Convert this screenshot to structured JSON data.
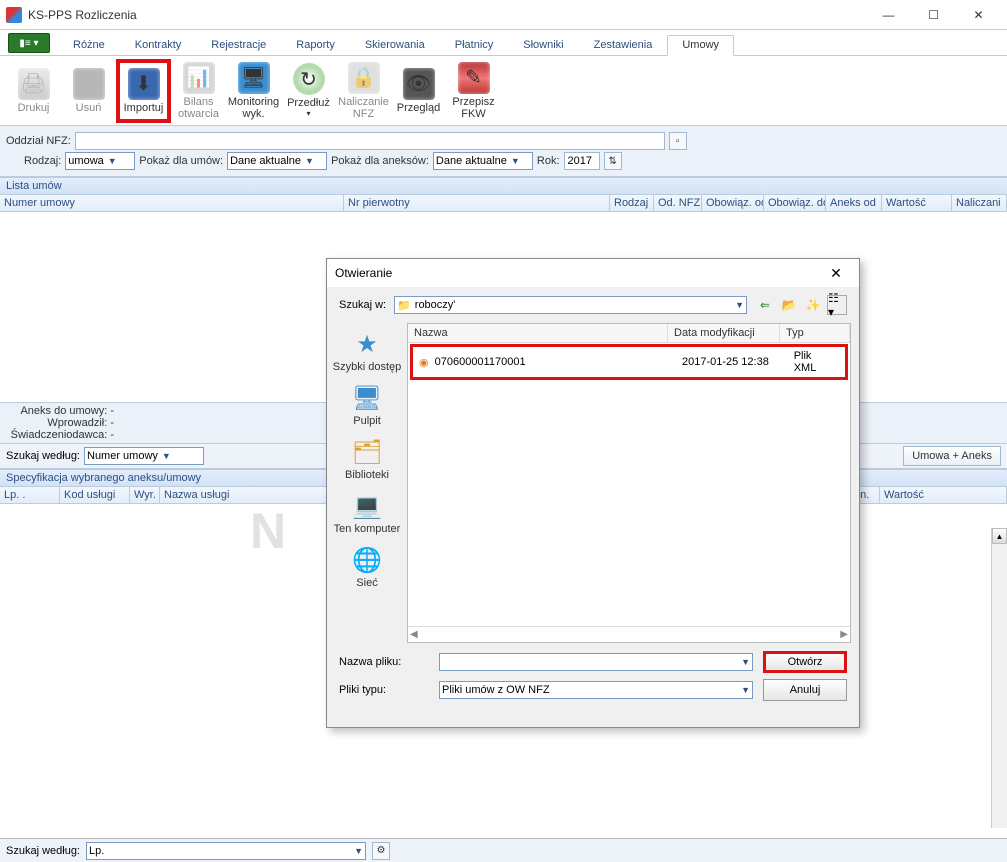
{
  "titlebar": {
    "title": "KS-PPS Rozliczenia"
  },
  "menu": {
    "items": [
      "Różne",
      "Kontrakty",
      "Rejestracje",
      "Raporty",
      "Skierowania",
      "Płatnicy",
      "Słowniki",
      "Zestawienia",
      "Umowy"
    ],
    "active": "Umowy"
  },
  "ribbon": {
    "drukuj": "Drukuj",
    "usun": "Usuń",
    "importuj": "Importuj",
    "bilans": "Bilans otwarcia",
    "monitoring": "Monitoring wyk.",
    "przedluz": "Przedłuż",
    "naliczanie": "Naliczanie NFZ",
    "przeglad": "Przegląd",
    "przepisz": "Przepisz FKW"
  },
  "filters": {
    "oddzial_label": "Oddział NFZ:",
    "rodzaj_label": "Rodzaj:",
    "rodzaj_value": "umowa",
    "pokaz_umow_label": "Pokaż dla umów:",
    "pokaz_umow_value": "Dane aktualne",
    "pokaz_aneks_label": "Pokaż dla aneksów:",
    "pokaz_aneks_value": "Dane aktualne",
    "rok_label": "Rok:",
    "rok_value": "2017"
  },
  "sections": {
    "lista_umow": "Lista umów",
    "spec": "Specyfikacja wybranego aneksu/umowy"
  },
  "cols1": [
    "Numer umowy",
    "Nr pierwotny",
    "Rodzaj",
    "Od. NFZ",
    "Obowiąz. od",
    "Obowiąz. do",
    "Aneks od",
    "Wartość",
    "Naliczani"
  ],
  "info": {
    "aneks": "Aneks do umowy: -",
    "wprowadzil": "Wprowadził: -",
    "swiad": "Świadczeniodawca: -",
    "szukaj_label": "Szukaj według:",
    "szukaj_value": "Numer umowy",
    "btn_umowa_aneks": "Umowa + Aneks"
  },
  "cols2": [
    "Lp. .",
    "Kod usługi",
    "Wyr.",
    "Nazwa usługi",
    "ena jedn.",
    "Wartość"
  ],
  "bottom": {
    "szukaj_label": "Szukaj według:",
    "szukaj_value": "Lp."
  },
  "dialog": {
    "title": "Otwieranie",
    "szukaj_w": "Szukaj w:",
    "folder": "roboczy'",
    "side": [
      "Szybki dostęp",
      "Pulpit",
      "Biblioteki",
      "Ten komputer",
      "Sieć"
    ],
    "head": {
      "nazwa": "Nazwa",
      "data": "Data modyfikacji",
      "typ": "Typ"
    },
    "row": {
      "name": "070600001170001",
      "date": "2017-01-25 12:38",
      "type": "Plik XML"
    },
    "nazwa_pliku": "Nazwa pliku:",
    "pliki_typu": "Pliki typu:",
    "typ_value": "Pliki umów z OW NFZ",
    "otworz": "Otwórz",
    "anuluj": "Anuluj"
  },
  "watermark": "N"
}
